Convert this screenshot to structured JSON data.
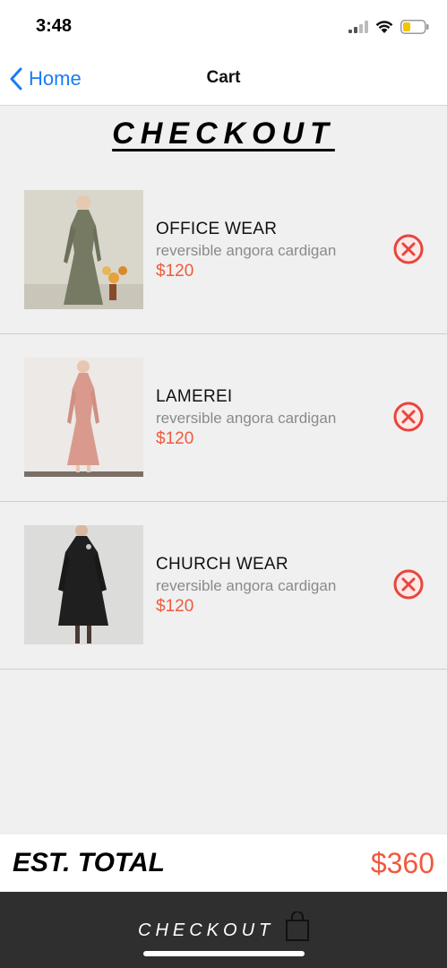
{
  "status_bar": {
    "time": "3:48"
  },
  "nav": {
    "back_label": "Home",
    "title": "Cart"
  },
  "heading": "CHECKOUT",
  "cart": {
    "items": [
      {
        "title": "OFFICE WEAR",
        "subtitle": "reversible angora cardigan",
        "price": "$120",
        "dress_color": "#767a63"
      },
      {
        "title": "LAMEREI",
        "subtitle": "reversible angora cardigan",
        "price": "$120",
        "dress_color": "#d99a8d"
      },
      {
        "title": "CHURCH WEAR",
        "subtitle": "reversible angora cardigan",
        "price": "$120",
        "dress_color": "#1f1f1f"
      }
    ]
  },
  "footer": {
    "total_label": "EST. TOTAL",
    "total_value": "$360",
    "checkout_label": "CHECKOUT"
  },
  "colors": {
    "accent": "#ef5a40",
    "link": "#1a7cf4",
    "remove": "#e8453c",
    "checkout_bg": "#2f2f2f"
  }
}
